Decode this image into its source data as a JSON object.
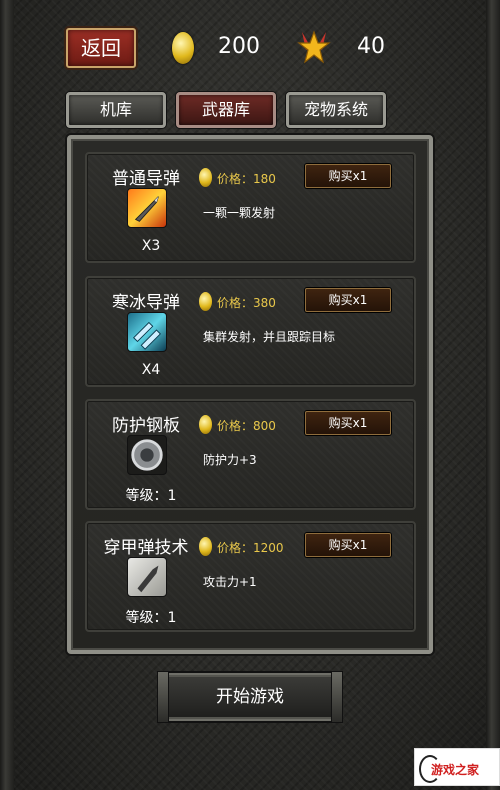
{
  "header": {
    "back_label": "返回",
    "coins": "200",
    "stars": "40"
  },
  "tabs": [
    {
      "label": "机库"
    },
    {
      "label": "武器库"
    },
    {
      "label": "宠物系统"
    }
  ],
  "items": [
    {
      "name": "普通导弹",
      "price": "价格：180",
      "buy_label": "购买x1",
      "description": "一颗一颗发射",
      "stat": "X3"
    },
    {
      "name": "寒冰导弹",
      "price": "价格：380",
      "buy_label": "购买x1",
      "description": "集群发射，并且跟踪目标",
      "stat": "X4"
    },
    {
      "name": "防护钢板",
      "price": "价格：800",
      "buy_label": "购买x1",
      "description": "防护力+3",
      "stat": "等级：1"
    },
    {
      "name": "穿甲弹技术",
      "price": "价格：1200",
      "buy_label": "购买x1",
      "description": "攻击力+1",
      "stat": "等级：1"
    }
  ],
  "start_label": "开始游戏",
  "watermark": "游戏之家",
  "colors": {
    "price": "#e9c84b",
    "back_button": "#9c2f25",
    "active_tab": "#6d2a25"
  }
}
